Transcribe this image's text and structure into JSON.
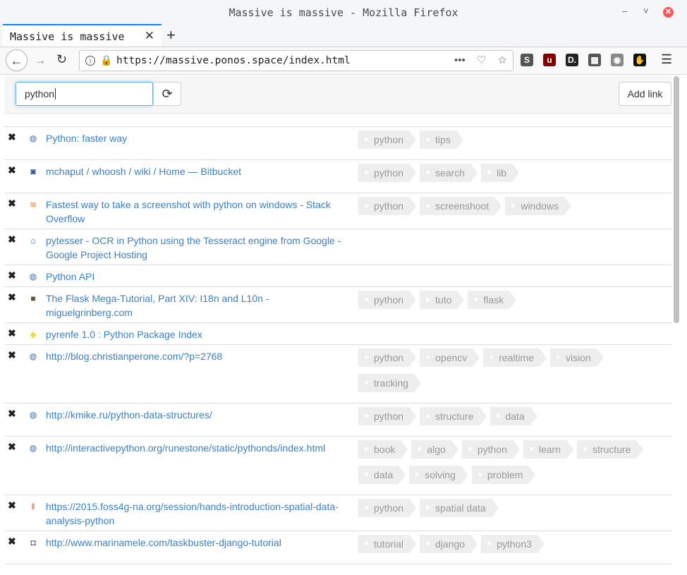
{
  "window": {
    "title": "Massive is massive - Mozilla Firefox",
    "minimize": "–",
    "restore": "˅",
    "close": "✕"
  },
  "tabs": [
    {
      "label": "Massive is massive",
      "close": "✕"
    }
  ],
  "new_tab": "+",
  "nav": {
    "url": "https://massive.ponos.space/index.html",
    "back": "←",
    "forward": "→",
    "reload": "↻"
  },
  "extensions": [
    {
      "name": "s-icon",
      "glyph": "S",
      "color": "#555555"
    },
    {
      "name": "ublock-icon",
      "glyph": "u",
      "color": "#800000"
    },
    {
      "name": "d-icon",
      "glyph": "D.",
      "color": "#222222"
    },
    {
      "name": "grid-icon",
      "glyph": "▦",
      "color": "#555555"
    },
    {
      "name": "globe-icon",
      "glyph": "◉",
      "color": "#888888"
    },
    {
      "name": "gnome-icon",
      "glyph": "✋",
      "color": "#111111"
    }
  ],
  "toolbar": {
    "search_value": "python",
    "add_link_label": "Add link",
    "refresh_icon": "⟳"
  },
  "rows": [
    {
      "title": "Python: faster way",
      "favicon": "globe-icon",
      "tags": [
        "python",
        "tips"
      ],
      "height": 47
    },
    {
      "title": "mchaput / whoosh / wiki / Home — Bitbucket",
      "favicon": "bitbucket-icon",
      "tags": [
        "python",
        "search",
        "lib"
      ],
      "height": 47
    },
    {
      "title": "Fastest way to take a screenshot with python on windows - Stack Overflow",
      "favicon": "stackoverflow-icon",
      "tags": [
        "python",
        "screenshoot",
        "windows"
      ],
      "height": 51
    },
    {
      "title": "pytesser - OCR in Python using the Tesseract engine from Google - Google Project Hosting",
      "favicon": "google-code-icon",
      "tags": [],
      "height": 51
    },
    {
      "title": "Python API",
      "favicon": "globe-icon",
      "tags": [],
      "height": 31
    },
    {
      "title": "The Flask Mega-Tutorial, Part XIV: I18n and L10n - miguelgrinberg.com",
      "favicon": "avatar-icon",
      "tags": [
        "python",
        "tuto",
        "flask"
      ],
      "height": 51
    },
    {
      "title": "pyrenfe 1.0 : Python Package Index",
      "favicon": "python-icon",
      "tags": [],
      "height": 31
    },
    {
      "title": "http://blog.christianperone.com/?p=2768",
      "favicon": "globe-icon",
      "tags": [
        "python",
        "opencv",
        "realtime",
        "vision",
        "tracking"
      ],
      "height": 83
    },
    {
      "title": "http://kmike.ru/python-data-structures/",
      "favicon": "globe-icon",
      "tags": [
        "python",
        "structure",
        "data"
      ],
      "height": 47
    },
    {
      "title": "http://interactivepython.org/runestone/static/pythonds/index.html",
      "favicon": "globe-icon",
      "tags": [
        "book",
        "algo",
        "python",
        "learn",
        "structure",
        "data",
        "solving",
        "problem"
      ],
      "height": 83
    },
    {
      "title": "https://2015.foss4g-na.org/session/hands-introduction-spatial-data-analysis-python",
      "favicon": "foss4g-icon",
      "tags": [
        "python",
        "spatial data"
      ],
      "height": 51
    },
    {
      "title": "http://www.marinamele.com/taskbuster-django-tutorial",
      "favicon": "robot-icon",
      "tags": [
        "tutorial",
        "django",
        "python3"
      ],
      "height": 47
    }
  ],
  "delete_glyph": "✖"
}
